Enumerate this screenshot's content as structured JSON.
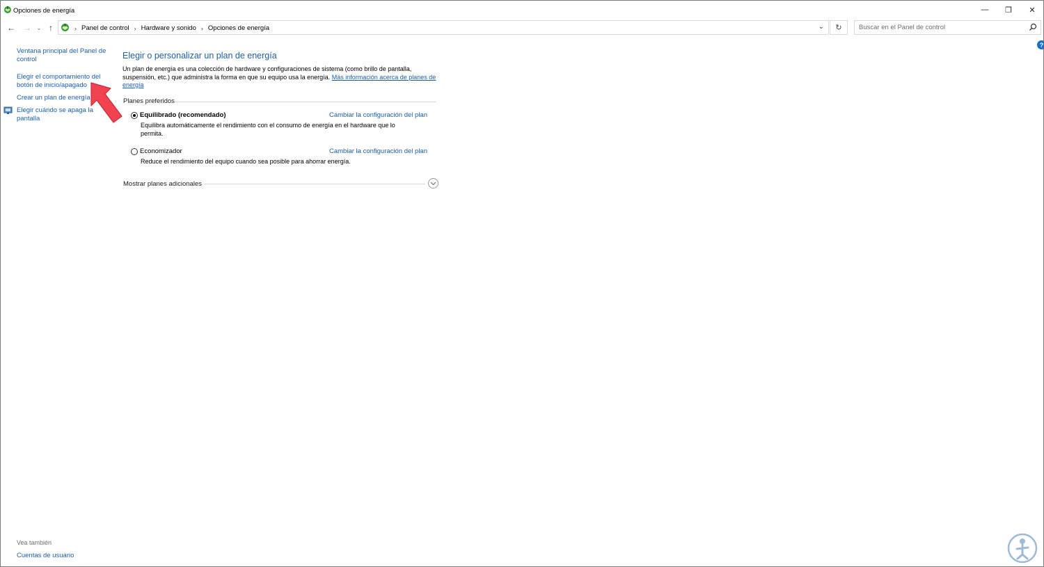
{
  "window": {
    "title": "Opciones de energía",
    "minimize_glyph": "—",
    "maximize_glyph": "❐",
    "close_glyph": "✕"
  },
  "navigation": {
    "back_glyph": "←",
    "forward_glyph": "→",
    "recent_glyph": "⌄",
    "up_glyph": "↑",
    "breadcrumbs": [
      "Panel de control",
      "Hardware y sonido",
      "Opciones de energía"
    ],
    "separator": "›",
    "dropdown_glyph": "⌄",
    "refresh_glyph": "↻",
    "search_placeholder": "Buscar en el Panel de control"
  },
  "help": {
    "glyph": "?"
  },
  "sidebar": {
    "items": [
      {
        "label": "Ventana principal del Panel de control"
      },
      {
        "label": "Elegir el comportamiento del botón de inicio/apagado"
      },
      {
        "label": "Crear un plan de energía"
      },
      {
        "label": "Elegir cuándo se apaga la pantalla",
        "icon": "monitor-shield-icon"
      }
    ],
    "see_also_label": "Vea también",
    "see_also_items": [
      {
        "label": "Cuentas de usuario"
      }
    ]
  },
  "main": {
    "title": "Elegir o personalizar un plan de energía",
    "description": "Un plan de energía es una colección de hardware y configuraciones de sistema (como brillo de pantalla, suspensión, etc.) que administra la forma en que su equipo usa la energía.",
    "description_link": "Más información acerca de planes de energía",
    "preferred_plans_label": "Planes preferidos",
    "plans": [
      {
        "name": "Equilibrado (recomendado)",
        "selected": true,
        "description": "Equilibra automáticamente el rendimiento con el consumo de energía en el hardware que lo permita.",
        "change_link": "Cambiar la configuración del plan"
      },
      {
        "name": "Economizador",
        "selected": false,
        "description": "Reduce el rendimiento del equipo cuando sea posible para ahorrar energía.",
        "change_link": "Cambiar la configuración del plan"
      }
    ],
    "show_more_label": "Mostrar planes adicionales"
  },
  "colors": {
    "link": "#1a5ea8",
    "heading": "#1e5fa0",
    "annotation_arrow": "#f0424f",
    "help_badge": "#1a6fc4"
  }
}
